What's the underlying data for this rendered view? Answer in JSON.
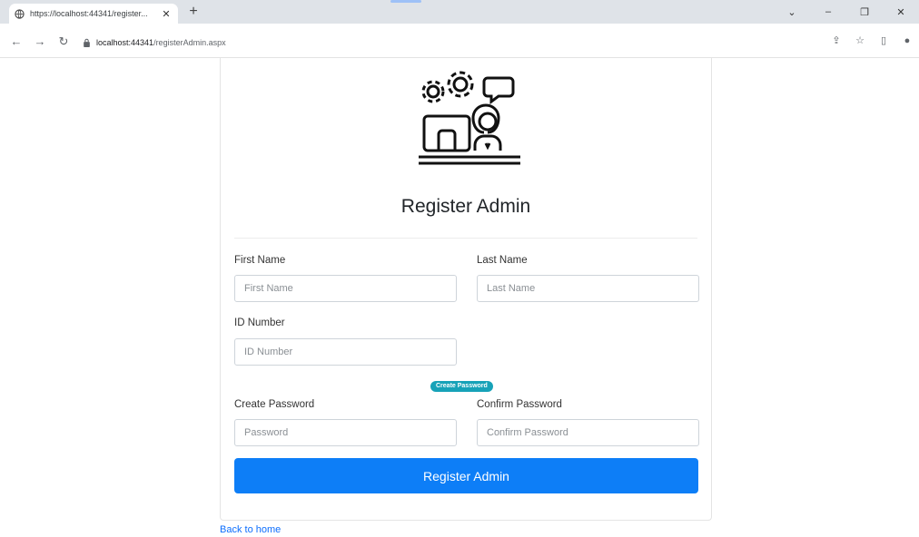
{
  "browser": {
    "tab_title": "https://localhost:44341/register...",
    "tab_close": "✕",
    "new_tab": "+",
    "url_host": "localhost:44341",
    "url_path": "/registerAdmin.aspx",
    "window_controls": [
      "⌄",
      "–",
      "❐",
      "✕"
    ],
    "toolbar_icons": [
      "share-icon",
      "star-icon",
      "sidebar-icon",
      "profile-icon"
    ]
  },
  "form": {
    "title": "Register Admin",
    "first_name_label": "First Name",
    "first_name_placeholder": "First Name",
    "last_name_label": "Last Name",
    "last_name_placeholder": "Last Name",
    "id_label": "ID Number",
    "id_placeholder": "ID Number",
    "badge": "Create Password",
    "password_label": "Create Password",
    "password_placeholder": "Password",
    "confirm_label": "Confirm Password",
    "confirm_placeholder": "Confirm Password",
    "submit_label": "Register Admin",
    "back_link": "Back to home"
  },
  "colors": {
    "primary": "#0d7ef7",
    "badge": "#17a2b8",
    "link": "#0d6efd"
  }
}
